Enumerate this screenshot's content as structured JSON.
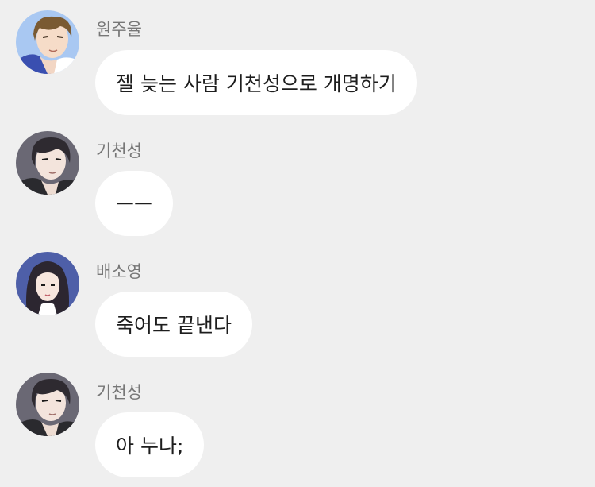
{
  "colors": {
    "background": "#efefef",
    "bubble": "#ffffff",
    "name_text": "#777777",
    "message_text": "#1d1d1d"
  },
  "messages": [
    {
      "sender": "원주율",
      "text": "젤 늦는 사람 기천성으로 개명하기",
      "avatar": "avatar-juyul"
    },
    {
      "sender": "기천성",
      "text": "ㅡㅡ",
      "avatar": "avatar-cheonseong"
    },
    {
      "sender": "배소영",
      "text": "죽어도 끝낸다",
      "avatar": "avatar-soyoung"
    },
    {
      "sender": "기천성",
      "text": "아 누나;",
      "avatar": "avatar-cheonseong"
    }
  ]
}
